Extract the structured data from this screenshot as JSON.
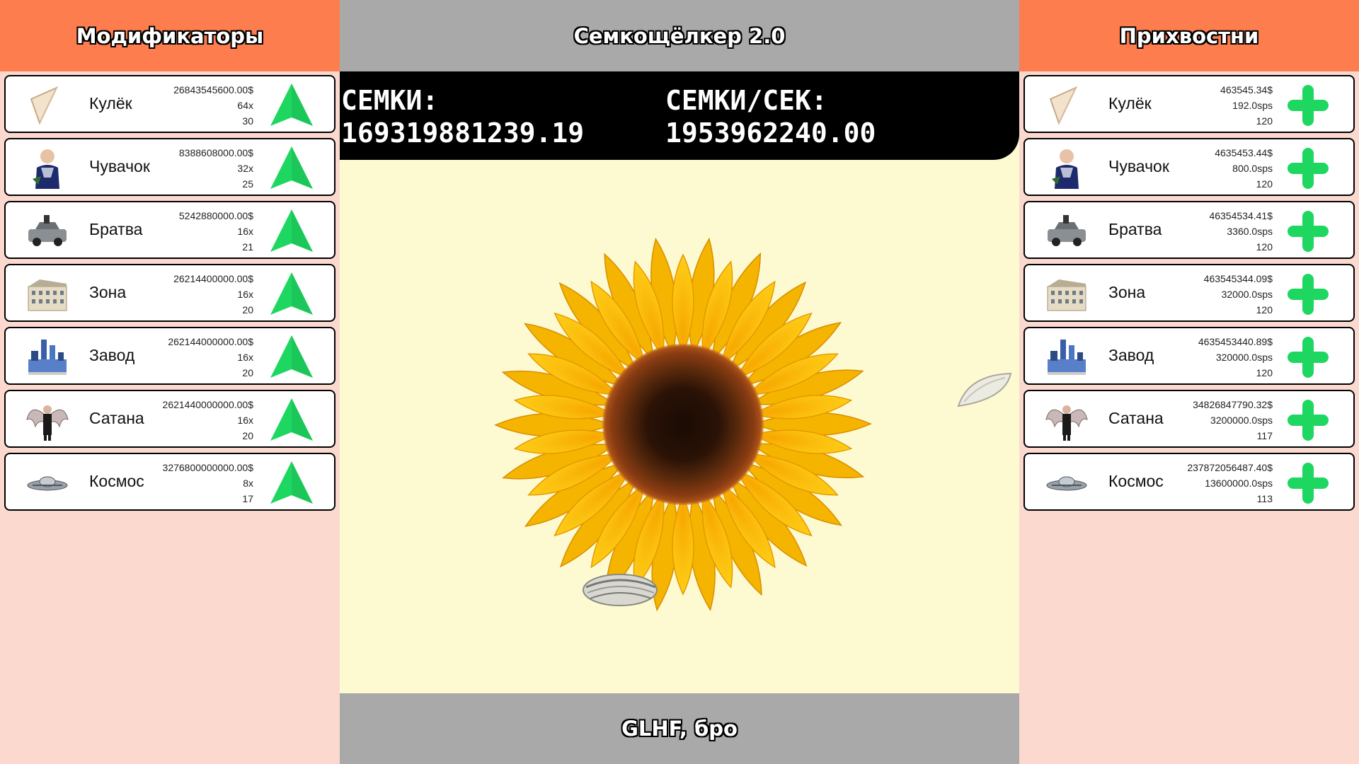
{
  "left_panel": {
    "title": "Модификаторы",
    "items": [
      {
        "name": "Кулёк",
        "price": "26843545600.00$",
        "multiplier": "64x",
        "level": "30",
        "icon": "paper-cone-icon"
      },
      {
        "name": "Чувачок",
        "price": "8388608000.00$",
        "multiplier": "32x",
        "level": "25",
        "icon": "dude-icon"
      },
      {
        "name": "Братва",
        "price": "5242880000.00$",
        "multiplier": "16x",
        "level": "21",
        "icon": "car-icon"
      },
      {
        "name": "Зона",
        "price": "26214400000.00$",
        "multiplier": "16x",
        "level": "20",
        "icon": "prison-building-icon"
      },
      {
        "name": "Завод",
        "price": "262144000000.00$",
        "multiplier": "16x",
        "level": "20",
        "icon": "factory-icon"
      },
      {
        "name": "Сатана",
        "price": "2621440000000.00$",
        "multiplier": "16x",
        "level": "20",
        "icon": "winged-man-icon"
      },
      {
        "name": "Космос",
        "price": "3276800000000.00$",
        "multiplier": "8x",
        "level": "17",
        "icon": "ufo-icon"
      }
    ],
    "button_icon": "up-arrow-icon",
    "button_color": "#1ed760"
  },
  "center": {
    "title": "Семкощёлкер 2.0",
    "seeds_label": "СЕМКИ:",
    "seeds_value": "169319881239.19",
    "rate_label": "СЕМКИ/СЕК:",
    "rate_value": "1953962240.00",
    "footer": "GLHF, бро",
    "clicker_icon": "sunflower-icon"
  },
  "right_panel": {
    "title": "Прихвостни",
    "items": [
      {
        "name": "Кулёк",
        "price": "463545.34$",
        "rate": "192.0sps",
        "count": "120",
        "icon": "paper-cone-icon"
      },
      {
        "name": "Чувачок",
        "price": "4635453.44$",
        "rate": "800.0sps",
        "count": "120",
        "icon": "dude-icon"
      },
      {
        "name": "Братва",
        "price": "46354534.41$",
        "rate": "3360.0sps",
        "count": "120",
        "icon": "car-icon"
      },
      {
        "name": "Зона",
        "price": "463545344.09$",
        "rate": "32000.0sps",
        "count": "120",
        "icon": "prison-building-icon"
      },
      {
        "name": "Завод",
        "price": "4635453440.89$",
        "rate": "320000.0sps",
        "count": "120",
        "icon": "factory-icon"
      },
      {
        "name": "Сатана",
        "price": "34826847790.32$",
        "rate": "3200000.0sps",
        "count": "117",
        "icon": "winged-man-icon"
      },
      {
        "name": "Космос",
        "price": "237872056487.40$",
        "rate": "13600000.0sps",
        "count": "113",
        "icon": "ufo-icon"
      }
    ],
    "button_icon": "plus-icon",
    "button_color": "#1ed760"
  },
  "colors": {
    "header_orange": "#fe7d4e",
    "header_gray": "#a9a9a9",
    "side_bg": "#fbd9cf",
    "center_bg": "#fdfad2",
    "stats_bg": "#000000"
  }
}
